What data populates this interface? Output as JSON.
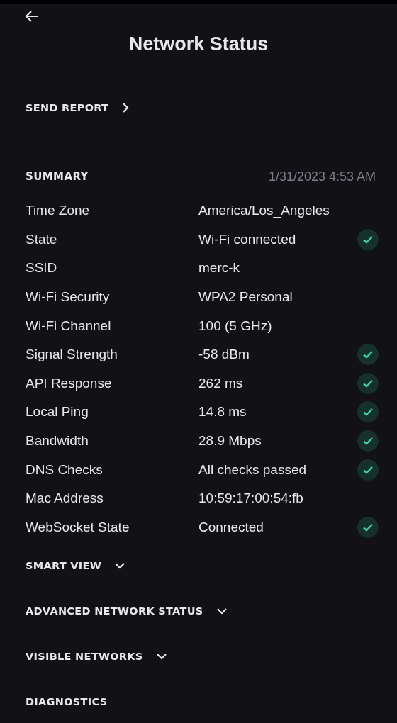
{
  "header": {
    "title": "Network Status"
  },
  "send_report": {
    "label": "SEND REPORT"
  },
  "summary": {
    "title": "SUMMARY",
    "timestamp": "1/31/2023 4:53 AM",
    "rows": [
      {
        "label": "Time Zone",
        "value": "America/Los_Angeles",
        "ok": false
      },
      {
        "label": "State",
        "value": "Wi-Fi connected",
        "ok": true
      },
      {
        "label": "SSID",
        "value": "merc-k",
        "ok": false
      },
      {
        "label": "Wi-Fi Security",
        "value": "WPA2 Personal",
        "ok": false
      },
      {
        "label": "Wi-Fi Channel",
        "value": "100 (5 GHz)",
        "ok": false
      },
      {
        "label": "Signal Strength",
        "value": "-58 dBm",
        "ok": true
      },
      {
        "label": "API Response",
        "value": "262 ms",
        "ok": true
      },
      {
        "label": "Local Ping",
        "value": "14.8 ms",
        "ok": true
      },
      {
        "label": "Bandwidth",
        "value": "28.9 Mbps",
        "ok": true
      },
      {
        "label": "DNS Checks",
        "value": "All checks passed",
        "ok": true
      },
      {
        "label": "Mac Address",
        "value": "10:59:17:00:54:fb",
        "ok": false
      },
      {
        "label": "WebSocket State",
        "value": "Connected",
        "ok": true
      }
    ]
  },
  "sections": [
    {
      "label": "SMART VIEW",
      "kind": "dropdown"
    },
    {
      "label": "ADVANCED NETWORK STATUS",
      "kind": "dropdown"
    },
    {
      "label": "VISIBLE NETWORKS",
      "kind": "dropdown"
    },
    {
      "label": "DIAGNOSTICS",
      "kind": "plain"
    }
  ]
}
